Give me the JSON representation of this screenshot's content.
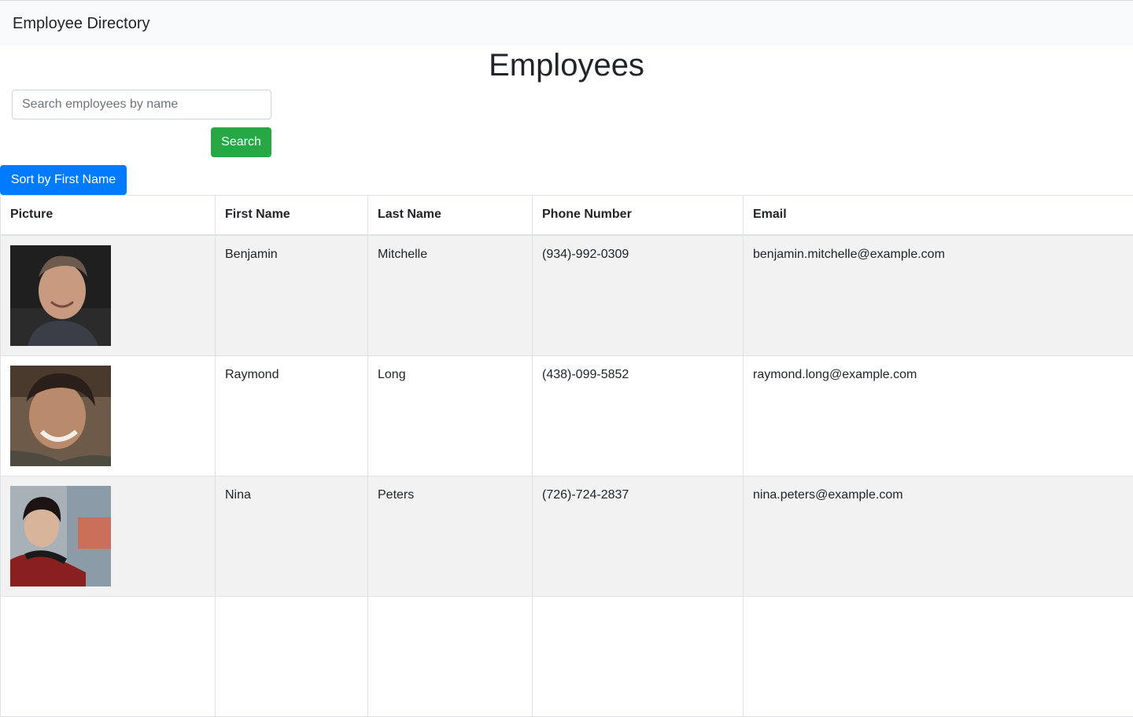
{
  "navbar": {
    "brand": "Employee Directory"
  },
  "page": {
    "title": "Employees"
  },
  "search": {
    "placeholder": "Search employees by name",
    "value": "",
    "button_label": "Search"
  },
  "sort": {
    "button_label": "Sort by First Name"
  },
  "table": {
    "headers": [
      "Picture",
      "First Name",
      "Last Name",
      "Phone Number",
      "Email"
    ],
    "rows": [
      {
        "picture": "portrait-photo",
        "first": "Benjamin",
        "last": "Mitchelle",
        "phone": "(934)-992-0309",
        "email": "benjamin.mitchelle@example.com"
      },
      {
        "picture": "portrait-photo",
        "first": "Raymond",
        "last": "Long",
        "phone": "(438)-099-5852",
        "email": "raymond.long@example.com"
      },
      {
        "picture": "portrait-photo",
        "first": "Nina",
        "last": "Peters",
        "phone": "(726)-724-2837",
        "email": "nina.peters@example.com"
      }
    ]
  },
  "colors": {
    "navbar_bg": "#f8f9fa",
    "search_button": "#28a745",
    "sort_button": "#007bff",
    "striped_row": "#f2f2f2"
  }
}
